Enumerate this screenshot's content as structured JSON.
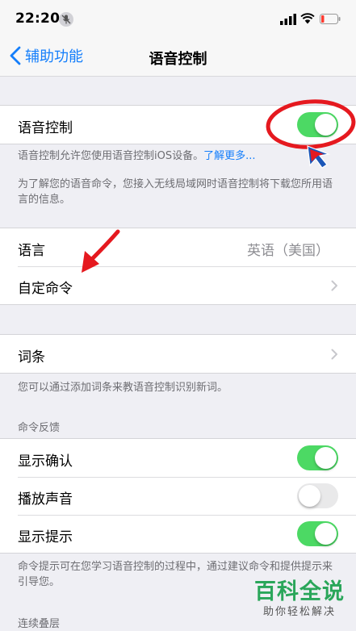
{
  "status_bar": {
    "time": "22:20"
  },
  "nav": {
    "back_label": "辅助功能",
    "title": "语音控制"
  },
  "voice_control": {
    "label": "语音控制",
    "enabled": true,
    "note_text": "语音控制允许您使用语音控制iOS设备。",
    "note_link": "了解更多...",
    "download_note": "为了解您的语音命令，您接入无线局域网时语音控制将下载您所用语言的信息。"
  },
  "language": {
    "label": "语言",
    "value": "英语（美国）"
  },
  "custom_commands": {
    "label": "自定命令"
  },
  "vocabulary": {
    "label": "词条",
    "note": "您可以通过添加词条来教语音控制识别新词。"
  },
  "command_feedback": {
    "header": "命令反馈",
    "show_confirmation": {
      "label": "显示确认",
      "enabled": true
    },
    "play_sound": {
      "label": "播放声音",
      "enabled": false
    },
    "show_hints": {
      "label": "显示提示",
      "enabled": true
    },
    "hints_note": "命令提示可在您学习语音控制的过程中，通过建议命令和提供提示来引导您。"
  },
  "continuous_overlay": {
    "header": "连续叠层"
  },
  "watermark": {
    "brand": "百科全说",
    "tagline": "助你轻松解决"
  },
  "colors": {
    "accent": "#147efb",
    "toggle_on": "#4cd964",
    "annotation": "#e5191f"
  }
}
